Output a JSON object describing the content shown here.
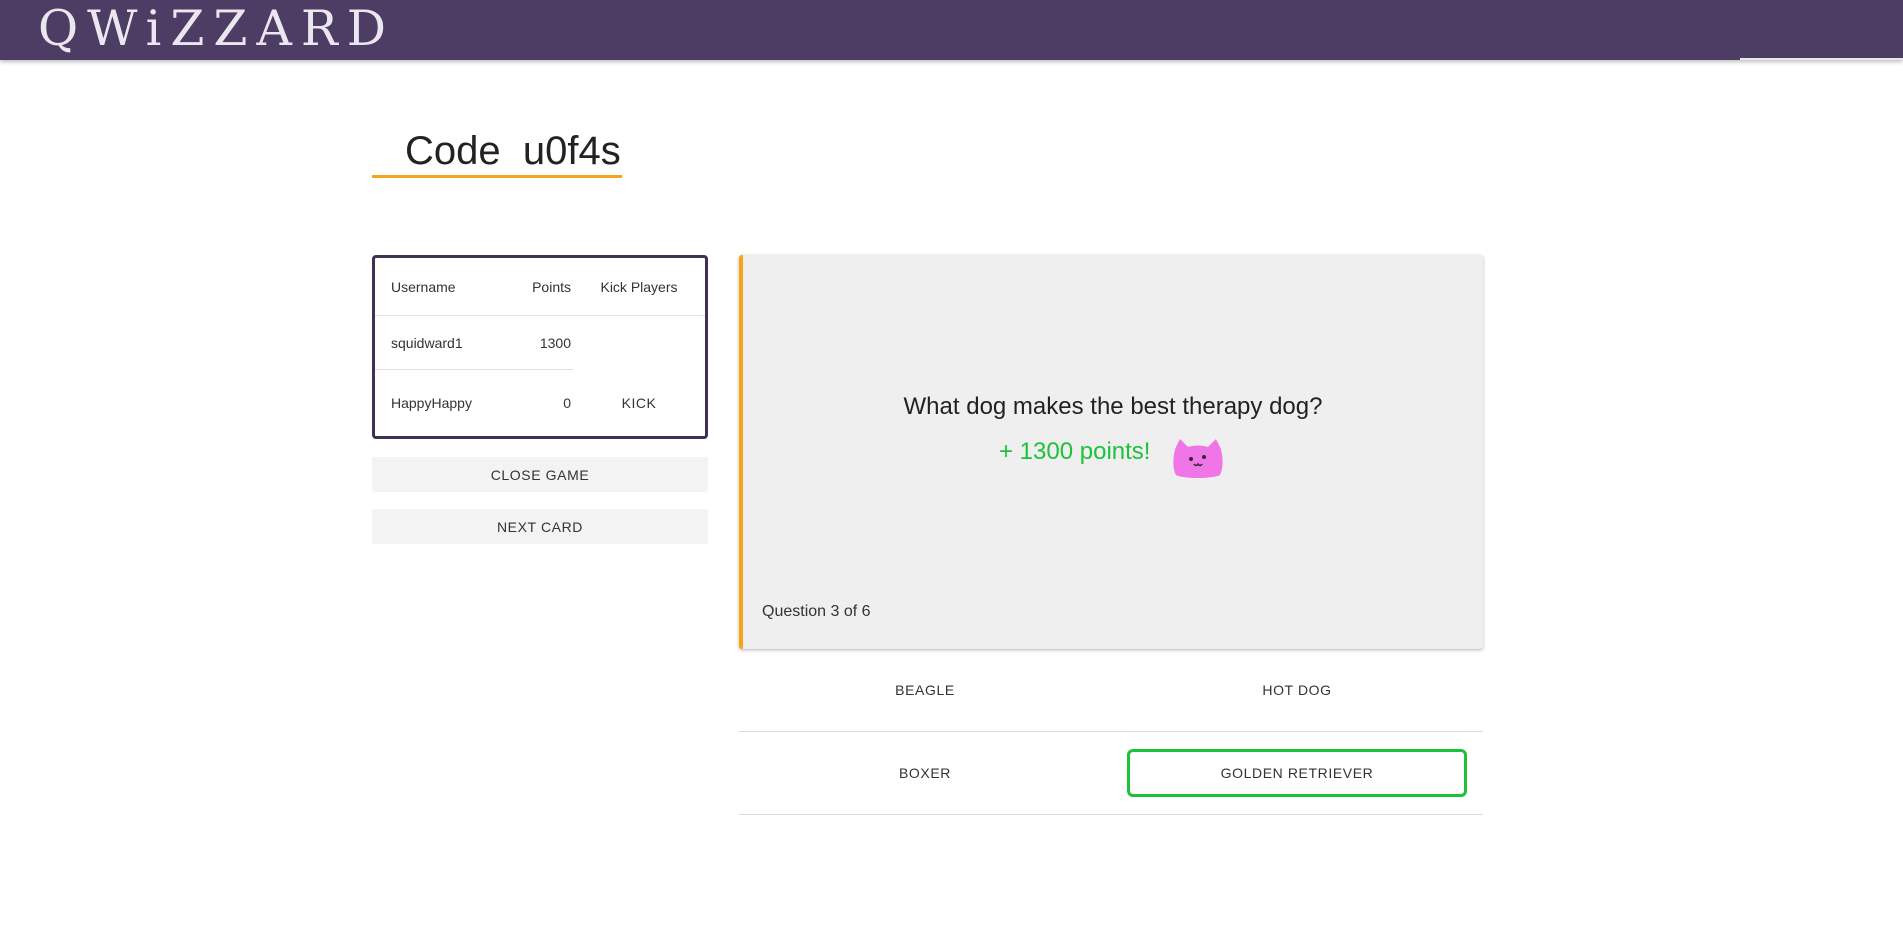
{
  "app": {
    "logo": "QWiZZARD"
  },
  "game": {
    "code_label": "Code  u0f4s"
  },
  "players": {
    "headers": {
      "username": "Username",
      "points": "Points",
      "kick": "Kick Players"
    },
    "rows": [
      {
        "username": "squidward1",
        "points": "1300",
        "kick": ""
      },
      {
        "username": "HappyHappy",
        "points": "0",
        "kick": "KICK"
      }
    ]
  },
  "controls": {
    "close_game": "CLOSE GAME",
    "next_card": "NEXT CARD"
  },
  "card": {
    "question": "What dog makes the best therapy dog?",
    "points_earned": "+ 1300 points!",
    "progress": "Question 3 of 6",
    "avatar_icon": "pink-cat-icon"
  },
  "answers": [
    {
      "label": "BEAGLE",
      "correct": false
    },
    {
      "label": "HOT DOG",
      "correct": false
    },
    {
      "label": "BOXER",
      "correct": false
    },
    {
      "label": "GOLDEN RETRIEVER",
      "correct": true
    }
  ],
  "colors": {
    "header_bg": "#4d3c63",
    "accent_orange": "#f4a51c",
    "correct_green": "#1ec23a",
    "card_bg": "#efefef",
    "cat_pink": "#f075e6"
  }
}
